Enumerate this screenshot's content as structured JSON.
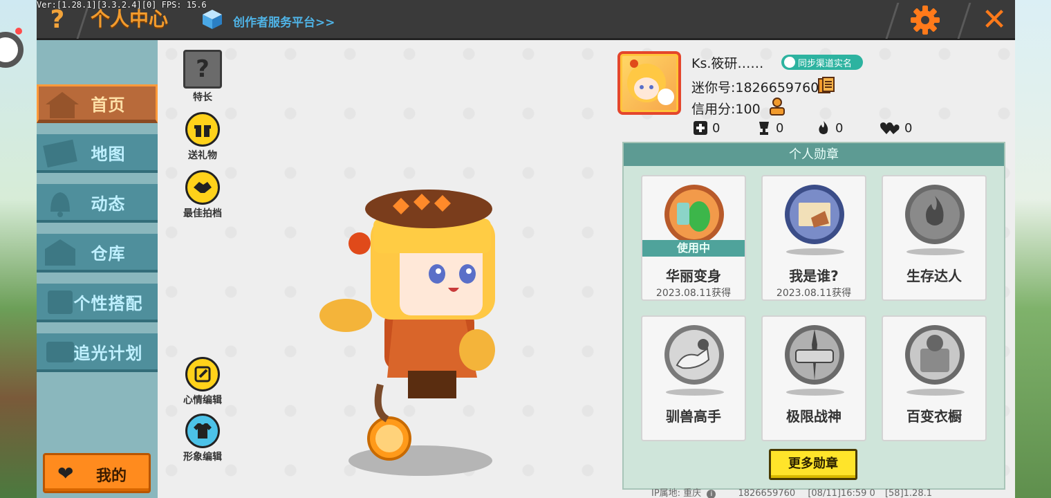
{
  "version_text": "Ver:[1.28.1][3.3.2.4][0] FPS: 15.6",
  "header": {
    "help_glyph": "?",
    "title": "个人中心",
    "creator_link": "创作者服务平台>>",
    "close_glyph": "✕"
  },
  "sidebar": {
    "items": [
      {
        "label": "首页",
        "icon": "house-icon",
        "active": true
      },
      {
        "label": "地图",
        "icon": "map-icon",
        "active": false
      },
      {
        "label": "动态",
        "icon": "bell-icon",
        "active": false
      },
      {
        "label": "仓库",
        "icon": "warehouse-icon",
        "active": false
      },
      {
        "label": "个性搭配",
        "icon": "outfit-icon",
        "active": false
      },
      {
        "label": "追光计划",
        "icon": "spotlight-icon",
        "active": false
      }
    ],
    "mine_label": "我的"
  },
  "side_actions": {
    "specialty": {
      "label": "特长",
      "glyph": "?"
    },
    "gift": {
      "label": "送礼物"
    },
    "partner": {
      "label": "最佳拍档"
    },
    "mood": {
      "label": "心情编辑"
    },
    "appearance": {
      "label": "形象编辑"
    }
  },
  "profile": {
    "nickname": "Ks.筱研……",
    "verify_label": "同步渠道实名",
    "mini_id": "迷你号:1826659760",
    "credit": "信用分:100",
    "stats": {
      "adds": "0",
      "likes": "0",
      "heat": "0",
      "hearts": "0"
    }
  },
  "medals": {
    "title": "个人勋章",
    "in_use_label": "使用中",
    "items": [
      {
        "name": "华丽变身",
        "date": "2023.08.11获得",
        "in_use": true,
        "color": "#f29a4a"
      },
      {
        "name": "我是谁?",
        "date": "2023.08.11获得",
        "in_use": false,
        "color": "#6b7fb8"
      },
      {
        "name": "生存达人",
        "date": "",
        "in_use": false,
        "color": "#8a8a8a"
      },
      {
        "name": "驯兽高手",
        "date": "",
        "in_use": false,
        "color": "#9a9a9a"
      },
      {
        "name": "极限战神",
        "date": "",
        "in_use": false,
        "color": "#9a9a9a"
      },
      {
        "name": "百变衣橱",
        "date": "",
        "in_use": false,
        "color": "#9a9a9a"
      }
    ],
    "more_label": "更多勋章"
  },
  "footer": {
    "ip_location": "IP属地: 重庆",
    "uid": "1826659760",
    "timestamp": "[08/11]16:59 0",
    "build": "[58]1.28.1"
  },
  "colors": {
    "accent_orange": "#f29b2d",
    "nav_teal": "#4f8f9c",
    "medal_teal": "#5d9b93",
    "more_yellow": "#ffe42a"
  }
}
